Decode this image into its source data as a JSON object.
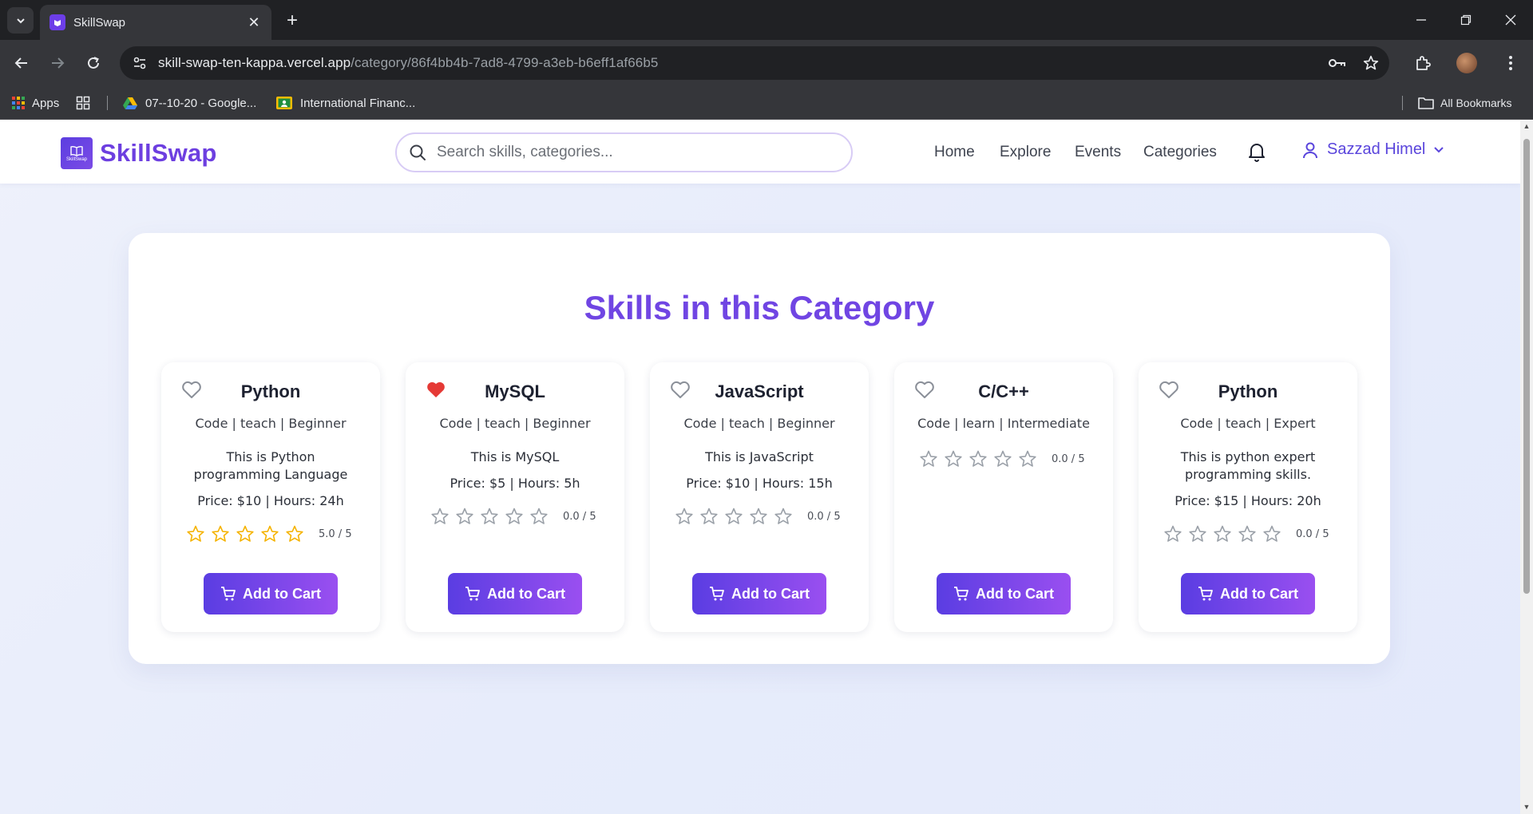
{
  "browser": {
    "tab_title": "SkillSwap",
    "url_host": "skill-swap-ten-kappa.vercel.app",
    "url_path": "/category/86f4bb4b-7ad8-4799-a3eb-b6eff1af66b5",
    "bookmarks": [
      {
        "label": "Apps",
        "icon": "apps-grid-icon"
      },
      {
        "label": "",
        "icon": "tab-groups-icon"
      },
      {
        "label": "07--10-20 - Google...",
        "icon": "google-drive-icon"
      },
      {
        "label": "International Financ...",
        "icon": "google-classroom-icon"
      }
    ],
    "all_bookmarks": "All Bookmarks"
  },
  "site": {
    "brand": "SkillSwap",
    "logo_caption": "SkillSwap",
    "search_placeholder": "Search skills, categories...",
    "nav": [
      "Home",
      "Explore",
      "Events",
      "Categories"
    ],
    "user_name": "Sazzad Himel"
  },
  "section_title": "Skills in this Category",
  "cards": [
    {
      "name": "Python",
      "meta": "Code | teach | Beginner",
      "description": "This is Python programming Language",
      "price_line": "Price: $10 | Hours: 24h",
      "rating": 5.0,
      "rating_text": "5.0 / 5",
      "favorited": false,
      "button": "Add to Cart"
    },
    {
      "name": "MySQL",
      "meta": "Code | teach | Beginner",
      "description": "This is MySQL",
      "price_line": "Price: $5 | Hours: 5h",
      "rating": 0.0,
      "rating_text": "0.0 / 5",
      "favorited": true,
      "button": "Add to Cart"
    },
    {
      "name": "JavaScript",
      "meta": "Code | teach | Beginner",
      "description": "This is JavaScript",
      "price_line": "Price: $10 | Hours: 15h",
      "rating": 0.0,
      "rating_text": "0.0 / 5",
      "favorited": false,
      "button": "Add to Cart"
    },
    {
      "name": "C/C++",
      "meta": "Code | learn | Intermediate",
      "description": "",
      "price_line": "",
      "rating": 0.0,
      "rating_text": "0.0 / 5",
      "favorited": false,
      "button": "Add to Cart"
    },
    {
      "name": "Python",
      "meta": "Code | teach | Expert",
      "description": "This is python expert programming skills.",
      "price_line": "Price: $15 | Hours: 20h",
      "rating": 0.0,
      "rating_text": "0.0 / 5",
      "favorited": false,
      "button": "Add to Cart"
    }
  ],
  "colors": {
    "brand": "#6d3fe0",
    "button_gradient_start": "#5a3de2",
    "button_gradient_end": "#9a4ff0",
    "star_filled": "#f5b301",
    "heart_favorited": "#e53935"
  }
}
